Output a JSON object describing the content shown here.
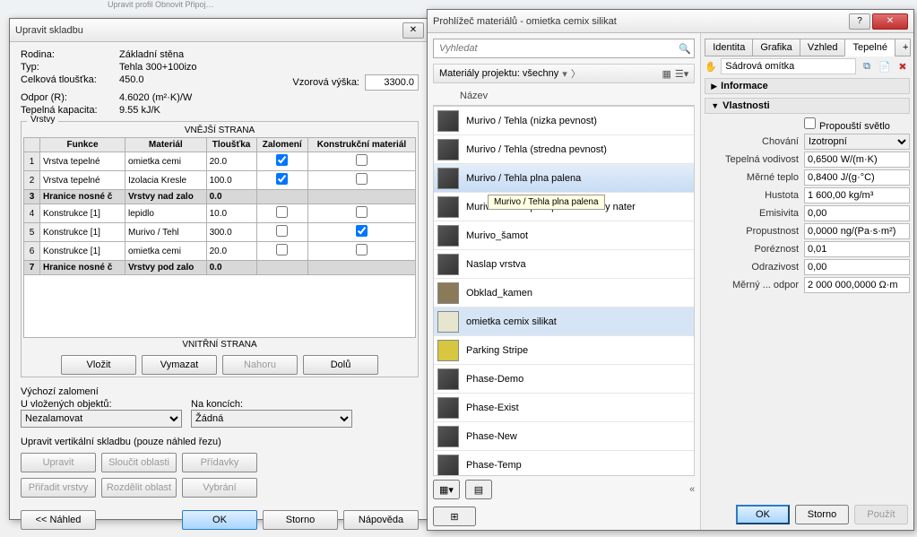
{
  "bg": {
    "ribbon": "Upravit profil  Obnovit    Připoj…"
  },
  "dlg1": {
    "title": "Upravit skladbu",
    "family_lbl": "Rodina:",
    "family": "Základní stěna",
    "type_lbl": "Typ:",
    "type": "Tehla 300+100izo",
    "thick_lbl": "Celková tloušťka:",
    "thick": "450.0",
    "sample_lbl": "Vzorová výška:",
    "sample": "3300.0",
    "r_lbl": "Odpor (R):",
    "r": "4.6020 (m²·K)/W",
    "cap_lbl": "Tepelná kapacita:",
    "cap": "9.55 kJ/K",
    "layers_title": "Vrstvy",
    "ext": "VNĚJŠÍ STRANA",
    "int": "VNITŘNÍ STRANA",
    "cols": {
      "func": "Funkce",
      "mat": "Materiál",
      "th": "Tloušťka",
      "wrap": "Zalomení",
      "struct": "Konstrukční materiál"
    },
    "rows": [
      {
        "n": "1",
        "func": "Vrstva tepelné",
        "mat": "omietka cemi",
        "th": "20.0",
        "wrap": true,
        "struct": false,
        "b": false
      },
      {
        "n": "2",
        "func": "Vrstva tepelné",
        "mat": "Izolacia Kresle",
        "th": "100.0",
        "wrap": true,
        "struct": false,
        "b": false
      },
      {
        "n": "3",
        "func": "Hranice nosné č",
        "mat": "Vrstvy nad zalo",
        "th": "0.0",
        "wrap": false,
        "struct": false,
        "b": true
      },
      {
        "n": "4",
        "func": "Konstrukce [1]",
        "mat": "lepidlo",
        "th": "10.0",
        "wrap": false,
        "struct": false,
        "b": false
      },
      {
        "n": "5",
        "func": "Konstrukce [1]",
        "mat": "Murivo / Tehl",
        "th": "300.0",
        "wrap": false,
        "struct": true,
        "b": false
      },
      {
        "n": "6",
        "func": "Konstrukce [1]",
        "mat": "omietka cemi",
        "th": "20.0",
        "wrap": false,
        "struct": false,
        "b": false
      },
      {
        "n": "7",
        "func": "Hranice nosné č",
        "mat": "Vrstvy pod zalo",
        "th": "0.0",
        "wrap": false,
        "struct": false,
        "b": true
      }
    ],
    "btns": {
      "insert": "Vložit",
      "delete": "Vymazat",
      "up": "Nahoru",
      "down": "Dolů"
    },
    "wrap_title": "Výchozí zalomení",
    "wrap_ins_lbl": "U vložených objektů:",
    "wrap_ins": "Nezalamovat",
    "wrap_end_lbl": "Na koncích:",
    "wrap_end": "Žádná",
    "vert_lbl": "Upravit vertikální skladbu (pouze náhled řezu)",
    "vbtns": {
      "modify": "Upravit",
      "merge": "Sloučit oblasti",
      "sweeps": "Přídavky",
      "assign": "Přiřadit vrstvy",
      "split": "Rozdělit oblast",
      "reveals": "Vybrání"
    },
    "bottom": {
      "preview": "<< Náhled",
      "ok": "OK",
      "cancel": "Storno",
      "help": "Nápověda"
    }
  },
  "dlg2": {
    "title": "Prohlížeč materiálů - omietka cemix silikat",
    "search_ph": "Vyhledat",
    "proj": "Materiály projektu: všechny",
    "name_hdr": "Název",
    "tooltip": "Murivo / Tehla plna palena",
    "materials": [
      {
        "label": "Murivo / Tehla (nizka pevnost)",
        "sel": false
      },
      {
        "label": "Murivo / Tehla (stredna pevnost)",
        "sel": false
      },
      {
        "label": "Murivo / Tehla plna palena",
        "sel": true
      },
      {
        "label": "Murivo / Tehla plna palena - biely nater",
        "sel": false,
        "tt": true
      },
      {
        "label": "Murivo_šamot",
        "sel": false
      },
      {
        "label": "Naslap vrstva",
        "sel": false
      },
      {
        "label": "Obklad_kamen",
        "sel": false,
        "sw": "#8a7a5a"
      },
      {
        "label": "omietka cemix silikat",
        "sel": false,
        "hl": true,
        "sw": "#e6e6d0"
      },
      {
        "label": "Parking Stripe",
        "sel": false,
        "sw": "#d6c640"
      },
      {
        "label": "Phase-Demo",
        "sel": false
      },
      {
        "label": "Phase-Exist",
        "sel": false
      },
      {
        "label": "Phase-New",
        "sel": false
      },
      {
        "label": "Phase-Temp",
        "sel": false
      }
    ],
    "tabs": {
      "identity": "Identita",
      "graphics": "Grafika",
      "appearance": "Vzhled",
      "thermal": "Tepelné"
    },
    "asset": "Sádrová omítka",
    "sec_info": "Informace",
    "sec_props": "Vlastnosti",
    "props": {
      "transmits_lbl": "Propouští světlo",
      "transmits": false,
      "behavior_lbl": "Chování",
      "behavior": "Izotropní",
      "cond_lbl": "Tepelná vodivost",
      "cond": "0,6500 W/(m·K)",
      "sh_lbl": "Měrné teplo",
      "sh": "0,8400 J/(g·°C)",
      "dens_lbl": "Hustota",
      "dens": "1 600,00 kg/m³",
      "emis_lbl": "Emisivita",
      "emis": "0,00",
      "perm_lbl": "Propustnost",
      "perm": "0,0000 ng/(Pa·s·m²)",
      "poro_lbl": "Poréznost",
      "poro": "0,01",
      "refl_lbl": "Odrazivost",
      "refl": "0,00",
      "res_lbl": "Měrný ... odpor",
      "res": "2 000 000,0000 Ω·m"
    },
    "footer": {
      "ok": "OK",
      "cancel": "Storno",
      "apply": "Použít"
    }
  }
}
